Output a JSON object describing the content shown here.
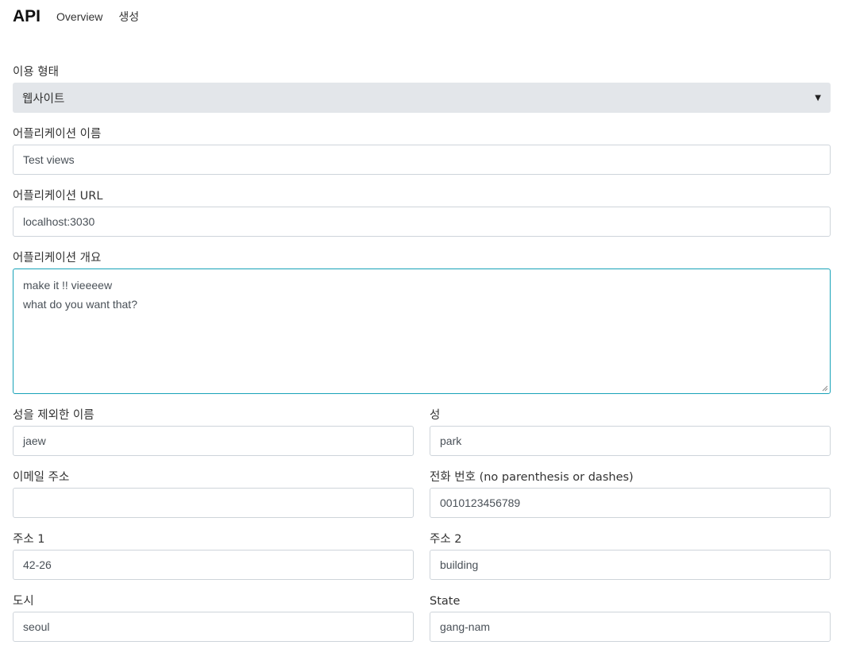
{
  "nav": {
    "brand": "API",
    "links": [
      "Overview",
      "생성"
    ]
  },
  "form": {
    "usage_type": {
      "label": "이용 형태",
      "value": "웹사이트",
      "icon": "caret-down-icon"
    },
    "app_name": {
      "label": "어플리케이션 이름",
      "value": "Test views"
    },
    "app_url": {
      "label": "어플리케이션 URL",
      "value": "localhost:3030"
    },
    "app_description": {
      "label": "어플리케이션 개요",
      "lines": [
        "make it !! vieeeew",
        "what do you want that?"
      ]
    },
    "first_name": {
      "label": "성을 제외한 이름",
      "value": "jaew"
    },
    "last_name": {
      "label": "성",
      "value": "park"
    },
    "email": {
      "label": "이메일 주소",
      "value": ""
    },
    "phone": {
      "label": "전화 번호 (no parenthesis or dashes)",
      "value": "0010123456789"
    },
    "address1": {
      "label": "주소 1",
      "value": "42-26"
    },
    "address2": {
      "label": "주소 2",
      "value": "building"
    },
    "city": {
      "label": "도시",
      "value": "seoul"
    },
    "state": {
      "label": "State",
      "value": "gang-nam"
    }
  },
  "colors": {
    "focus_border": "#17a2b8",
    "input_border": "#ced4da",
    "select_bg": "#e3e6ea"
  }
}
